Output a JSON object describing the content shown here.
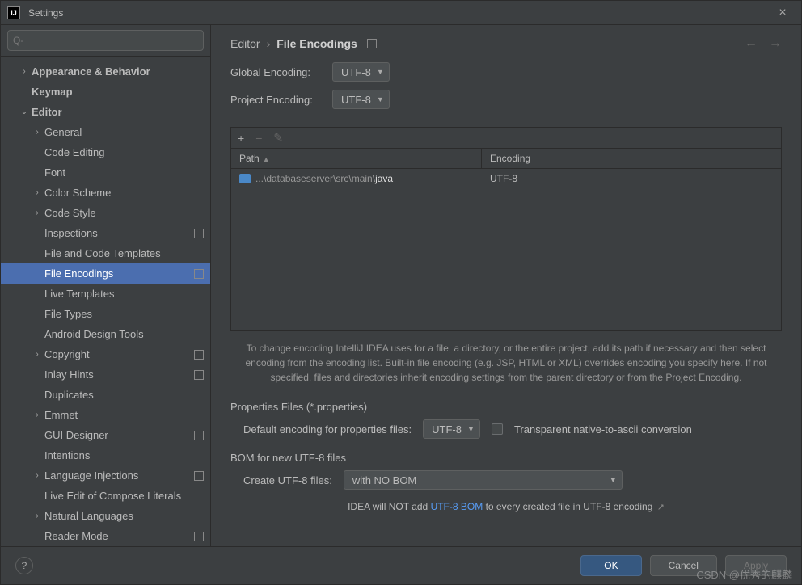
{
  "window": {
    "title": "Settings",
    "close": "×"
  },
  "search": {
    "placeholder": "Q-"
  },
  "sidebar": {
    "items": [
      {
        "label": "Appearance & Behavior",
        "indent": 1,
        "chev": "›",
        "bold": true
      },
      {
        "label": "Keymap",
        "indent": 1,
        "bold": true
      },
      {
        "label": "Editor",
        "indent": 1,
        "chev": "⌄",
        "bold": true
      },
      {
        "label": "General",
        "indent": 2,
        "chev": "›"
      },
      {
        "label": "Code Editing",
        "indent": 2
      },
      {
        "label": "Font",
        "indent": 2
      },
      {
        "label": "Color Scheme",
        "indent": 2,
        "chev": "›"
      },
      {
        "label": "Code Style",
        "indent": 2,
        "chev": "›"
      },
      {
        "label": "Inspections",
        "indent": 2,
        "badge": true
      },
      {
        "label": "File and Code Templates",
        "indent": 2
      },
      {
        "label": "File Encodings",
        "indent": 2,
        "badge": true,
        "selected": true
      },
      {
        "label": "Live Templates",
        "indent": 2
      },
      {
        "label": "File Types",
        "indent": 2
      },
      {
        "label": "Android Design Tools",
        "indent": 2
      },
      {
        "label": "Copyright",
        "indent": 2,
        "chev": "›",
        "badge": true
      },
      {
        "label": "Inlay Hints",
        "indent": 2,
        "badge": true
      },
      {
        "label": "Duplicates",
        "indent": 2
      },
      {
        "label": "Emmet",
        "indent": 2,
        "chev": "›"
      },
      {
        "label": "GUI Designer",
        "indent": 2,
        "badge": true
      },
      {
        "label": "Intentions",
        "indent": 2
      },
      {
        "label": "Language Injections",
        "indent": 2,
        "chev": "›",
        "badge": true
      },
      {
        "label": "Live Edit of Compose Literals",
        "indent": 2
      },
      {
        "label": "Natural Languages",
        "indent": 2,
        "chev": "›"
      },
      {
        "label": "Reader Mode",
        "indent": 2,
        "badge": true
      }
    ]
  },
  "breadcrumb": {
    "parent": "Editor",
    "sep": "›",
    "current": "File Encodings"
  },
  "form": {
    "global_label": "Global Encoding:",
    "global_value": "UTF-8",
    "project_label": "Project Encoding:",
    "project_value": "UTF-8"
  },
  "table": {
    "col_path": "Path",
    "col_enc": "Encoding",
    "row_path_prefix": "...\\databaseserver\\src\\main\\",
    "row_path_suffix": "java",
    "row_enc": "UTF-8"
  },
  "hint": "To change encoding IntelliJ IDEA uses for a file, a directory, or the entire project, add its path if necessary and then select encoding from the encoding list. Built-in file encoding (e.g. JSP, HTML or XML) overrides encoding you specify here. If not specified, files and directories inherit encoding settings from the parent directory or from the Project Encoding.",
  "props": {
    "section": "Properties Files (*.properties)",
    "default_label": "Default encoding for properties files:",
    "default_value": "UTF-8",
    "checkbox_label": "Transparent native-to-ascii conversion"
  },
  "bom": {
    "section": "BOM for new UTF-8 files",
    "create_label": "Create UTF-8 files:",
    "create_value": "with NO BOM",
    "hint_prefix": "IDEA will NOT add ",
    "hint_link": "UTF-8 BOM",
    "hint_suffix": " to every created file in UTF-8 encoding"
  },
  "footer": {
    "help": "?",
    "ok": "OK",
    "cancel": "Cancel",
    "apply": "Apply"
  },
  "watermark": "CSDN @优秀的麒麟"
}
